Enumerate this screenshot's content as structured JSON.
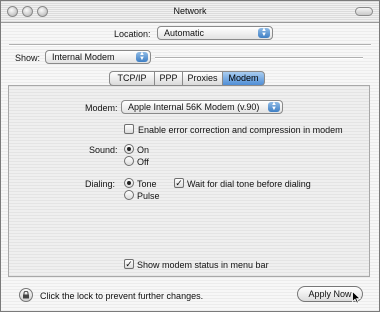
{
  "window": {
    "title": "Network"
  },
  "location": {
    "label": "Location:",
    "value": "Automatic"
  },
  "show": {
    "label": "Show:",
    "value": "Internal Modem"
  },
  "tabs": [
    {
      "label": "TCP/IP"
    },
    {
      "label": "PPP"
    },
    {
      "label": "Proxies"
    },
    {
      "label": "Modem",
      "selected": true
    }
  ],
  "modem": {
    "label": "Modem:",
    "value": "Apple Internal 56K Modem (v.90)",
    "error_correction_label": "Enable error correction and compression in modem",
    "error_correction_checked": false
  },
  "sound": {
    "label": "Sound:",
    "on_label": "On",
    "off_label": "Off",
    "selected": "On"
  },
  "dialing": {
    "label": "Dialing:",
    "tone_label": "Tone",
    "pulse_label": "Pulse",
    "selected": "Tone",
    "wait_label": "Wait for dial tone before dialing",
    "wait_checked": true
  },
  "status_menu": {
    "label": "Show modem status in menu bar",
    "checked": true
  },
  "footer": {
    "lock_text": "Click the lock to prevent further changes.",
    "apply_label": "Apply Now"
  },
  "colors": {
    "accent": "#4f8ed6",
    "tab_selected": "#a9cdf0"
  },
  "icons": [
    "lock-icon",
    "updown-arrows-icon",
    "checkmark-icon",
    "pointer-cursor-icon"
  ]
}
